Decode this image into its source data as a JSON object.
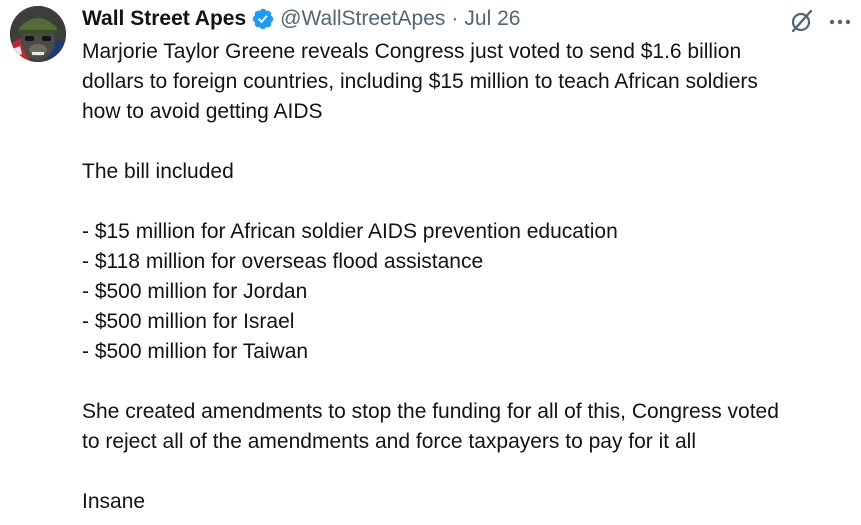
{
  "author": {
    "display_name": "Wall Street Apes",
    "handle": "@WallStreetApes",
    "date": "Jul 26",
    "separator": "·"
  },
  "icons": {
    "verified": "verified-badge-icon",
    "grok": "grok-icon",
    "more": "more-options-icon",
    "accent": "#1d9bf0"
  },
  "tweet": {
    "intro": [
      "Marjorie Taylor Greene reveals Congress just voted to send $1.6 billion",
      "dollars to foreign countries, including $15 million to teach African soldiers",
      "how to avoid getting AIDS"
    ],
    "bill_heading": "The bill included",
    "bill_items": [
      "- $15 million for African soldier AIDS prevention education",
      "- $118 million for overseas flood assistance",
      "- $500 million for Jordan",
      "- $500 million for Israel",
      "- $500 million for Taiwan"
    ],
    "conclusion": [
      "She created amendments to stop the funding for all of this, Congress voted",
      "to reject all of the amendments and force taxpayers to pay for it all"
    ],
    "closing": "Insane"
  }
}
